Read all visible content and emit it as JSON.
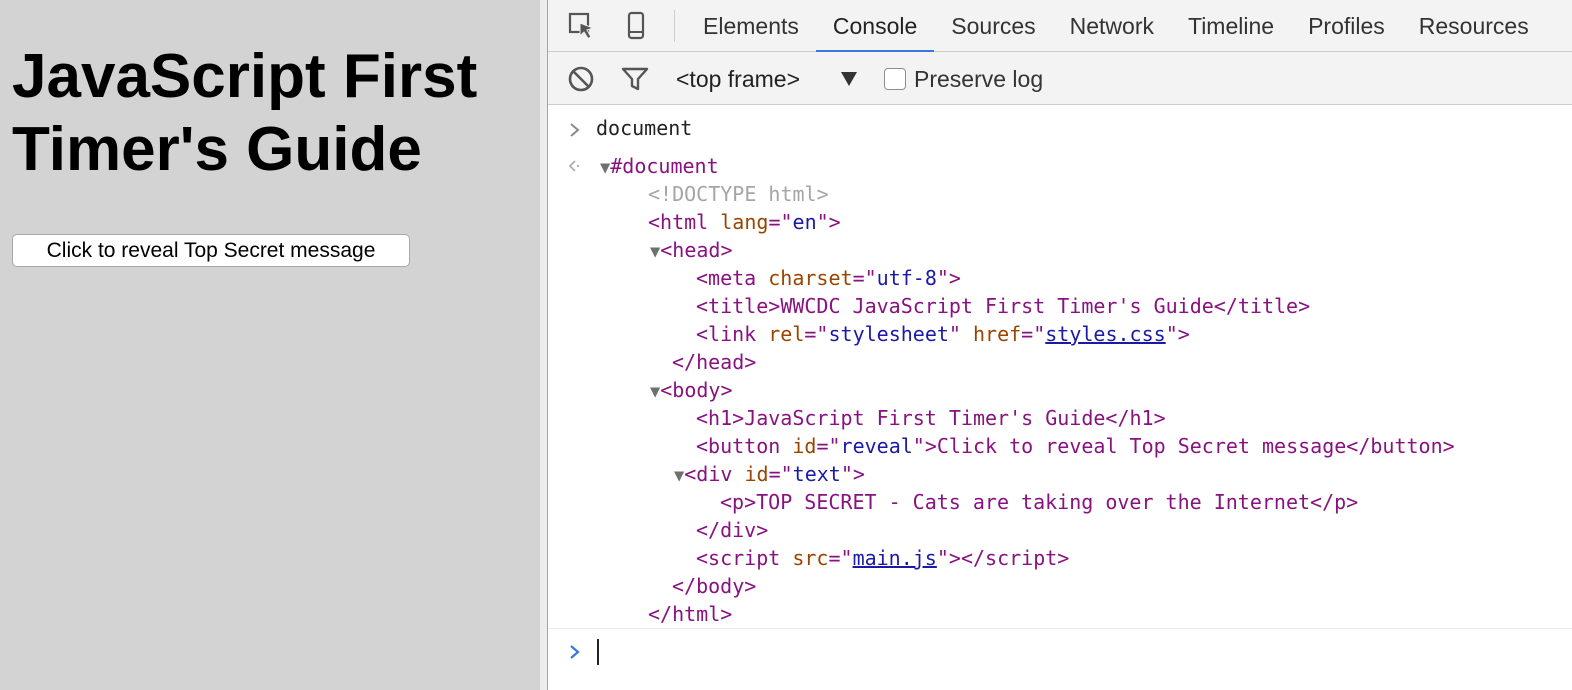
{
  "page": {
    "heading": "JavaScript First Timer's Guide",
    "button_label": "Click to reveal Top Secret message"
  },
  "devtools": {
    "toolbar_icons": [
      "inspect-element-icon",
      "device-mode-icon"
    ],
    "tabs": [
      {
        "label": "Elements",
        "active": false
      },
      {
        "label": "Console",
        "active": true
      },
      {
        "label": "Sources",
        "active": false
      },
      {
        "label": "Network",
        "active": false
      },
      {
        "label": "Timeline",
        "active": false
      },
      {
        "label": "Profiles",
        "active": false
      },
      {
        "label": "Resources",
        "active": false
      }
    ],
    "console_toolbar": {
      "icons": [
        "clear-console-icon",
        "filter-icon"
      ],
      "frame_selector": "<top frame>",
      "preserve_log_label": "Preserve log",
      "preserve_log_checked": false
    },
    "console": {
      "input_expression": "document",
      "output_root": "#document",
      "tree": {
        "doctype": "<!DOCTYPE html>",
        "html_open_tag": "html",
        "html_attr_name": "lang",
        "html_attr_value": "en",
        "head_tag": "head",
        "meta_tag": "meta",
        "meta_attr_name": "charset",
        "meta_attr_value": "utf-8",
        "title_tag": "title",
        "title_text": "WWCDC JavaScript First Timer's Guide",
        "link_tag": "link",
        "link_rel_name": "rel",
        "link_rel_value": "stylesheet",
        "link_href_name": "href",
        "link_href_value": "styles.css",
        "body_tag": "body",
        "h1_tag": "h1",
        "h1_text": "JavaScript First Timer's Guide",
        "button_tag": "button",
        "button_attr_name": "id",
        "button_attr_value": "reveal",
        "button_text": "Click to reveal Top Secret message",
        "div_tag": "div",
        "div_attr_name": "id",
        "div_attr_value": "text",
        "p_tag": "p",
        "p_text": "TOP SECRET - Cats are taking over the Internet",
        "script_tag": "script",
        "script_attr_name": "src",
        "script_attr_value": "main.js"
      }
    }
  }
}
